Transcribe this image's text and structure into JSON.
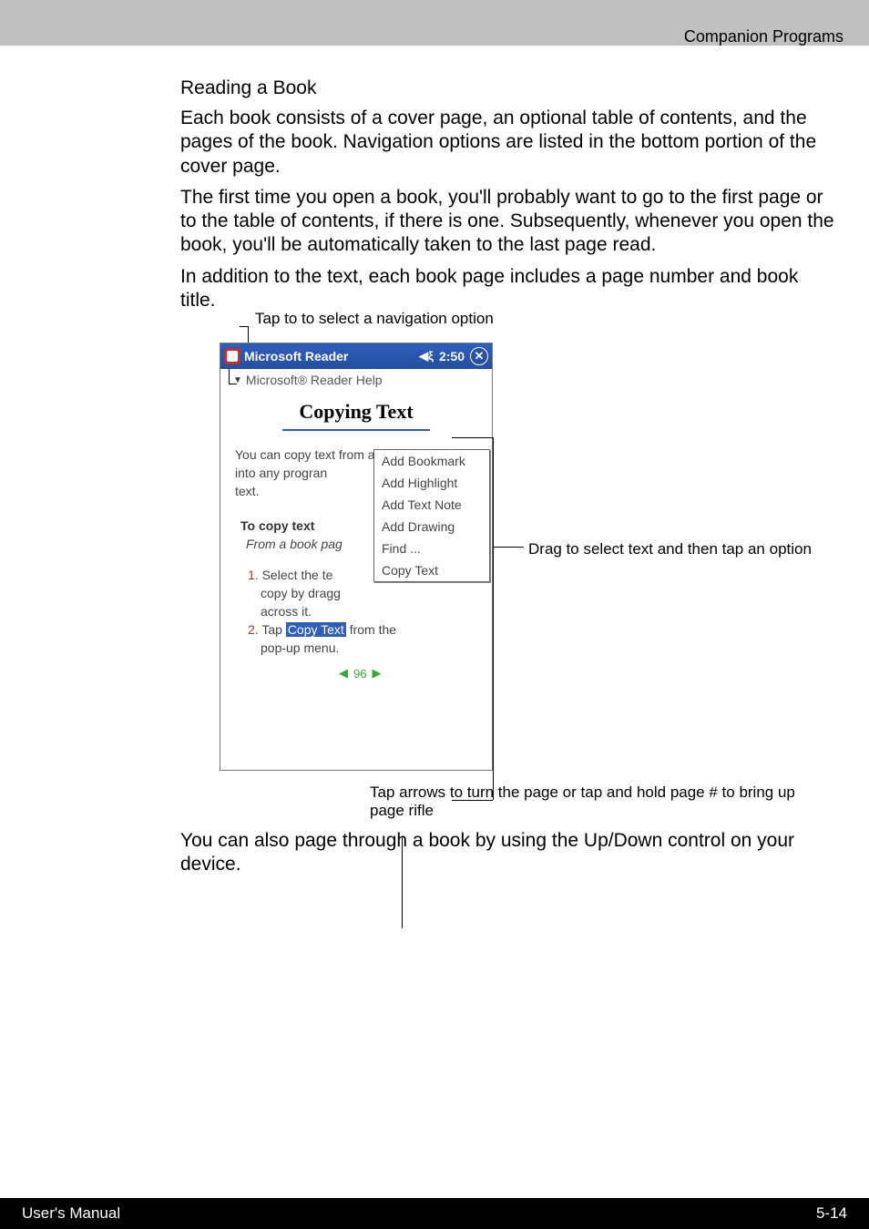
{
  "header": {
    "right": "Companion Programs"
  },
  "section": {
    "title": "Reading a Book",
    "p1": "Each book consists of a cover page, an optional table of contents, and the pages of the book. Navigation options are listed in the bottom portion of the cover page.",
    "p2": "The first time you open a book, you'll probably want to go to the first page or to the table of contents, if there is one. Subsequently, whenever you open the book, you'll be automatically taken to the last page read.",
    "p3": "In addition to the text, each book page includes a page number and book title."
  },
  "captions": {
    "top": "Tap to to select a navigation option",
    "right": "Drag to select text and then tap an option",
    "bottom": "Tap arrows to turn the page or tap and hold page # to bring up page rifle"
  },
  "device": {
    "titlebar": {
      "app": "Microsoft Reader",
      "time": "2:50"
    },
    "crumb": "Microsoft® Reader Help",
    "copying_title": "Copying Text",
    "body": {
      "line1": "You  can  copy  text  from  a  book",
      "line2": "into  any  progran",
      "line3": "text.",
      "subhead": "To copy text",
      "italic": "From a book pag",
      "step1_pre": "1.",
      "step1_txt": "Select  the  te",
      "step1b": "copy  by  dragg",
      "step1c": "across it.",
      "step2_pre": "2.",
      "step2_txt1": "Tap",
      "step2_hl": "Copy  Text",
      "step2_txt2": "from   the",
      "step2b": "pop-up menu.",
      "page_num": "96"
    },
    "popup": {
      "i0": "Add Bookmark",
      "i1": "Add Highlight",
      "i2": "Add Text Note",
      "i3": "Add Drawing",
      "i4": "Find ...",
      "i5": "Copy Text"
    }
  },
  "below": "You can also page through a book by using the Up/Down control on your device.",
  "footer": {
    "left": "User's Manual",
    "right": "5-14"
  }
}
